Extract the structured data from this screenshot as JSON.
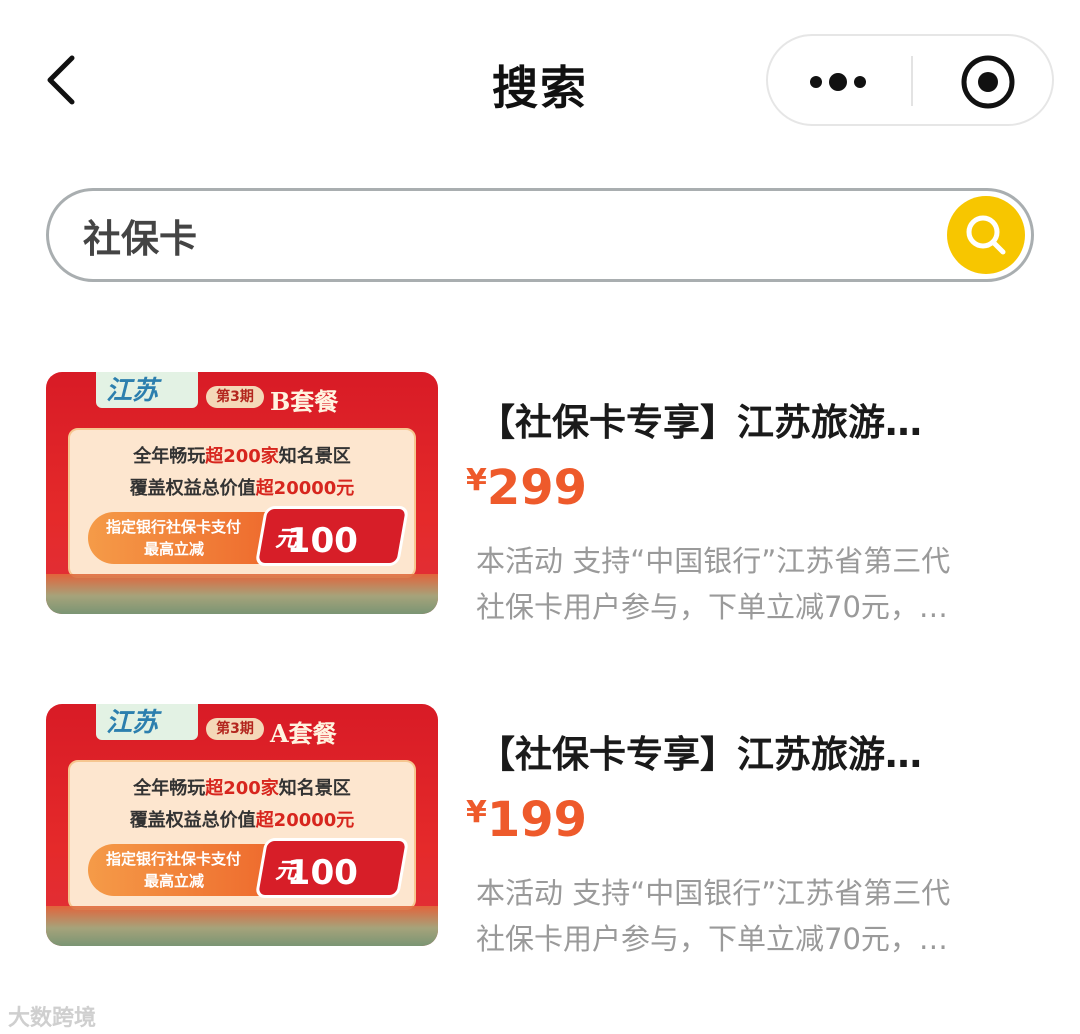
{
  "nav": {
    "title": "搜索"
  },
  "search": {
    "value": "社保卡"
  },
  "results": [
    {
      "title": "【社保卡专享】江苏旅游…",
      "currency": "¥",
      "price": "299",
      "desc_line1": "本活动 支持“中国银行”江苏省第三代",
      "desc_line2": "社保卡用户参与，下单立减70元，…",
      "thumb": {
        "issue": "第3期",
        "package": "B套餐",
        "line1_pre": "全年畅玩",
        "line1_hl": "超200家",
        "line1_post": "知名景区",
        "line2_pre": "覆盖权益总价值",
        "line2_hl": "超20000元",
        "badge_l1": "指定银行社保卡支付",
        "badge_l2": "最高立减",
        "badge_amount": "100",
        "badge_unit": "元"
      }
    },
    {
      "title": "【社保卡专享】江苏旅游…",
      "currency": "¥",
      "price": "199",
      "desc_line1": "本活动 支持“中国银行”江苏省第三代",
      "desc_line2": "社保卡用户参与，下单立减70元，…",
      "thumb": {
        "issue": "第3期",
        "package": "A套餐",
        "line1_pre": "全年畅玩",
        "line1_hl": "超200家",
        "line1_post": "知名景区",
        "line2_pre": "覆盖权益总价值",
        "line2_hl": "超20000元",
        "badge_l1": "指定银行社保卡支付",
        "badge_l2": "最高立减",
        "badge_amount": "100",
        "badge_unit": "元"
      }
    }
  ],
  "watermark": "大数跨境",
  "colors": {
    "price": "#ee5a2b",
    "search_button": "#f7c600",
    "banner_red": "#d81b26"
  },
  "icons": [
    "back-arrow-icon",
    "more-dots-icon",
    "target-close-icon",
    "search-icon"
  ]
}
